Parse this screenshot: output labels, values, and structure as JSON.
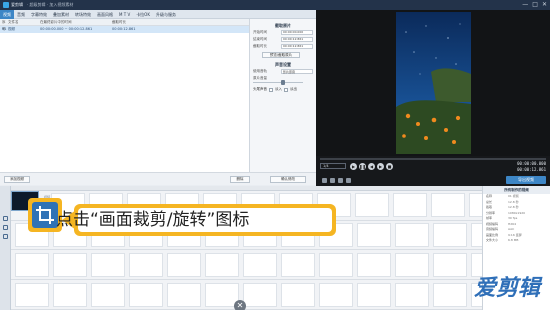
{
  "titlebar": {
    "app_name": "爱剪辑",
    "window_title": "· 超级剪辑 · 加入视频素材",
    "controls": [
      "—",
      "□",
      "✕"
    ]
  },
  "menu": {
    "tabs": [
      "视频",
      "音频",
      "字幕特效",
      "叠加素材",
      "转场特效",
      "画面风格",
      "M T V",
      "卡拉OK",
      "升级与服务"
    ],
    "active_index": 0
  },
  "media_list": {
    "headers": [
      "序号",
      "文件名",
      "在最终影片中的时间",
      "截取时长"
    ],
    "rows": [
      [
        "01",
        "视频",
        "00:00:00.000 ~ 00:00:12.861",
        "00:00:12.861"
      ]
    ]
  },
  "properties": {
    "clip_section_title": "截取原片",
    "start_label": "开始时间",
    "start_value": "00:00:00.000",
    "end_label": "结束时间",
    "end_value": "00:00:12.861",
    "duration_label": "截取时长",
    "duration_value": "00:00:12.861",
    "preview_button": "预览/截取原片",
    "audio_section_title": "声音设置",
    "mode_label": "使用音轨",
    "mode_value": "影片原音",
    "volume_label": "原片音量",
    "volume_level": 0.6,
    "fade_label": "头尾声音",
    "fade_in": "淡入",
    "fade_out": "淡出"
  },
  "media_footer": {
    "add_video": "添加视频",
    "delete": "删除",
    "confirm": "确认修改"
  },
  "controls": {
    "ratio": "1/4",
    "time_current": "00:00:00.000",
    "time_total": "00:00:12.861",
    "export_label": "导出视频"
  },
  "timeline": {
    "clip_name": "视频",
    "info_title": "所有制作的视频",
    "info_rows": [
      [
        "名称",
        "01 视频"
      ],
      [
        "总长",
        "12.8 秒"
      ],
      [
        "截取",
        "12.8 秒"
      ],
      [
        "分辨率",
        "1080x1920"
      ],
      [
        "帧率",
        "30 fps"
      ],
      [
        "视频编码",
        "H264"
      ],
      [
        "音频编码",
        "AAC"
      ],
      [
        "画面比例",
        "9:16 竖屏"
      ],
      [
        "文件大小",
        "6.8 MB"
      ]
    ]
  },
  "callout": {
    "text": "点击“画面裁剪/旋转”图标"
  },
  "logo": {
    "text": "爱剪辑"
  },
  "colors": {
    "accent": "#3d86c6",
    "callout": "#f5b522",
    "titlebar": "#23334a"
  },
  "icons": [
    "crop-rotate-icon",
    "play-icon",
    "pause-icon",
    "prev-icon",
    "next-icon",
    "stop-icon",
    "close-icon",
    "add-icon"
  ]
}
